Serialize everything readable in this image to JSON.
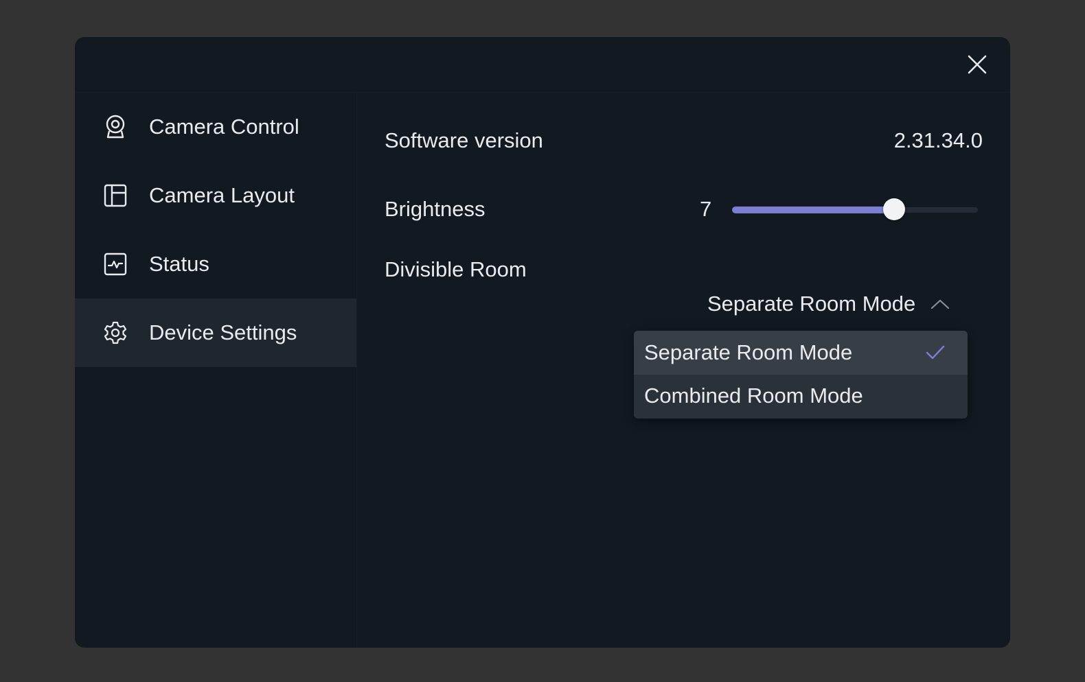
{
  "dialog": {
    "close_icon": "close-icon"
  },
  "sidebar": {
    "items": [
      {
        "label": "Camera Control",
        "icon": "webcam-icon",
        "active": false
      },
      {
        "label": "Camera Layout",
        "icon": "layout-icon",
        "active": false
      },
      {
        "label": "Status",
        "icon": "status-activity-icon",
        "active": false
      },
      {
        "label": "Device Settings",
        "icon": "gear-icon",
        "active": true
      }
    ]
  },
  "settings": {
    "software_version": {
      "label": "Software version",
      "value": "2.31.34.0"
    },
    "brightness": {
      "label": "Brightness",
      "value": "7",
      "slider_fraction": 0.66
    },
    "divisible_room": {
      "label": "Divisible Room",
      "selected": "Separate Room Mode",
      "chevron_icon": "chevron-up-icon",
      "options": [
        {
          "label": "Separate Room Mode",
          "selected": true
        },
        {
          "label": "Combined Room Mode",
          "selected": false
        }
      ]
    }
  },
  "colors": {
    "accent": "#7d7fd2",
    "dialog_bg": "#121920",
    "backdrop": "#333333",
    "active_nav_bg": "#1f262e",
    "menu_bg": "#2b3138"
  }
}
